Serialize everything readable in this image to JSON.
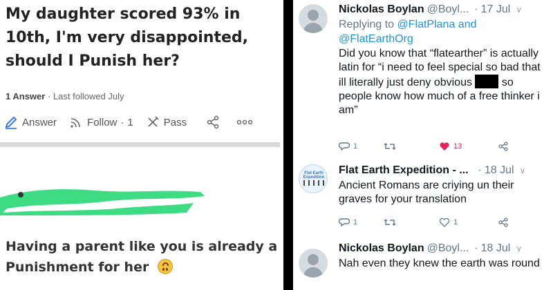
{
  "quora": {
    "question": "My daughter scored 93% in 10th, I'm very disappointed, should I Punish her?",
    "answers_count": "1 Answer",
    "meta_sep": "·",
    "last_followed": "Last followed July",
    "actions": {
      "answer": "Answer",
      "follow": "Follow",
      "follow_sep": "·",
      "follow_count": "1",
      "pass": "Pass"
    },
    "answer_text": "Having a parent like you is already a Punishment for her"
  },
  "tweets": [
    {
      "name": "Nickolas Boylan",
      "handle": "@Boyl...",
      "time": "17 Jul",
      "replying_to_label": "Replying to",
      "replying_to_1": "@FlatPlana",
      "replying_and": "and",
      "replying_to_2": "@FlatEarthOrg",
      "text_before": "Did you know that “flatearther” is actually latin for “i need to feel special so bad that ill literally just deny obvious",
      "text_after": "so people know how much of a free thinker i am”",
      "replies": "1",
      "likes": "13"
    },
    {
      "name": "Flat Earth Expedition - ...",
      "time": "18 Jul",
      "avatar_label": "Flat Earth Expedition",
      "text": "Ancient Romans are criying un their graves for your translation",
      "replies": "1",
      "likes": "1"
    },
    {
      "name": "Nickolas Boylan",
      "handle": "@Boyl...",
      "time": "18 Jul",
      "text": "Nah even they knew the earth was round"
    }
  ],
  "colors": {
    "link": "#1b95e0",
    "like": "#e0245e",
    "scribble": "#3ddc84",
    "muted": "#657786"
  }
}
